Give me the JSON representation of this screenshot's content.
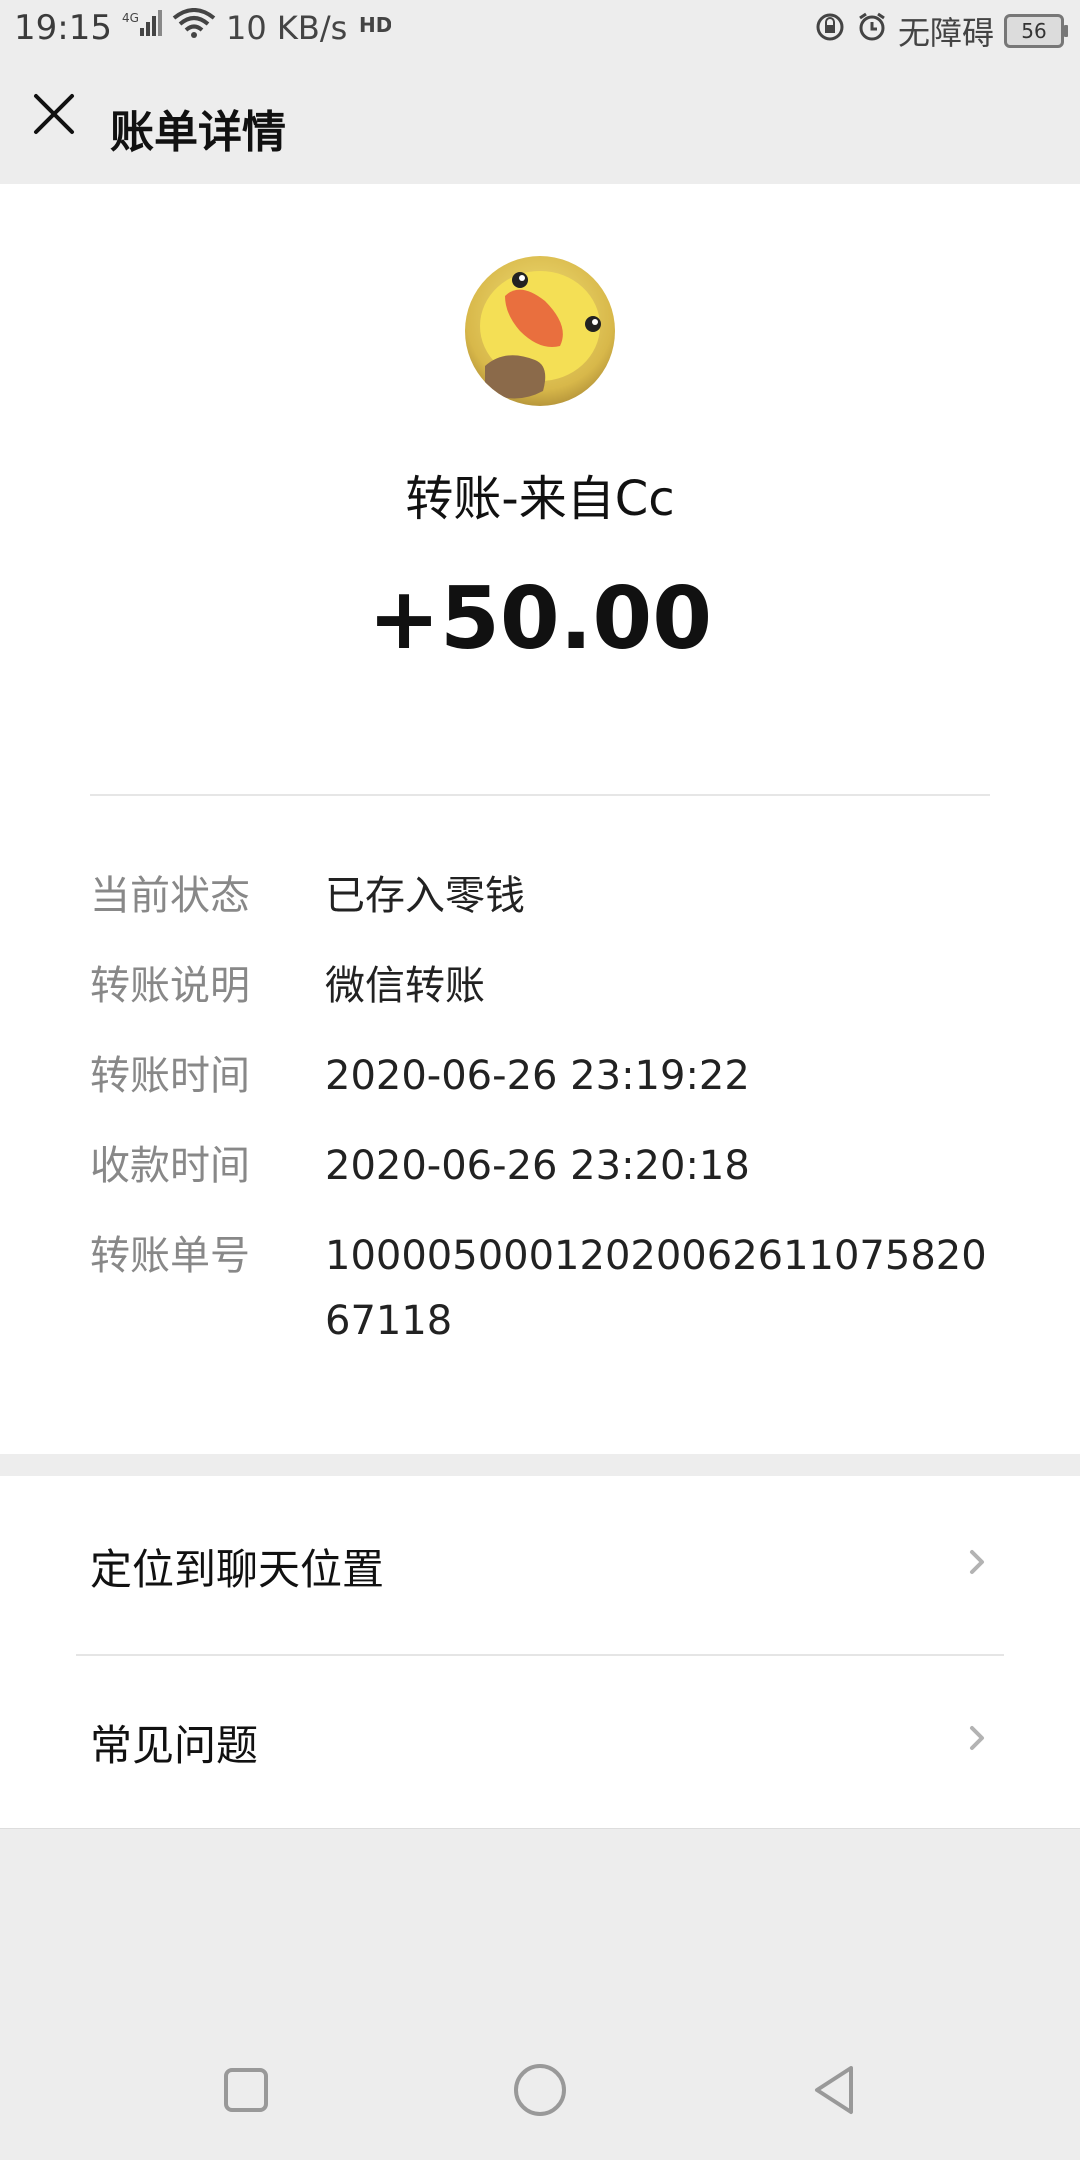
{
  "status_bar": {
    "time": "19:15",
    "network_speed": "10 KB/s",
    "accessibility": "无障碍",
    "battery": "56"
  },
  "header": {
    "title": "账单详情"
  },
  "transfer": {
    "title": "转账-来自Cc",
    "amount": "+50.00"
  },
  "details": {
    "rows": [
      {
        "label": "当前状态",
        "value": "已存入零钱"
      },
      {
        "label": "转账说明",
        "value": "微信转账"
      },
      {
        "label": "转账时间",
        "value": "2020-06-26 23:19:22"
      },
      {
        "label": "收款时间",
        "value": "2020-06-26 23:20:18"
      },
      {
        "label": "转账单号",
        "value": "1000050001202006261107582067118"
      }
    ]
  },
  "actions": {
    "items": [
      {
        "label": "定位到聊天位置"
      },
      {
        "label": "常见问题"
      }
    ]
  },
  "icons": {
    "close": "close-icon",
    "chevron": "chevron-right-icon",
    "nav_square": "square-icon",
    "nav_circle": "circle-icon",
    "nav_back": "triangle-back-icon"
  }
}
